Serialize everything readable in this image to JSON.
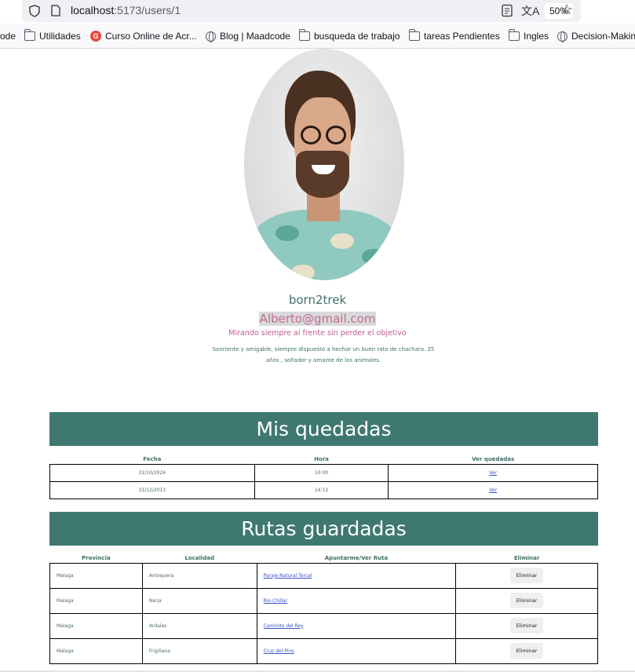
{
  "browser": {
    "url_host": "localhost",
    "url_rest": ":5173/users/1",
    "zoom": "50%",
    "bookmarks": [
      {
        "label": "ode",
        "icon": "none"
      },
      {
        "label": "Utilidades",
        "icon": "folder-icon"
      },
      {
        "label": "Curso Online de Acr...",
        "icon": "g-logo-icon"
      },
      {
        "label": "Blog | Maadcode",
        "icon": "globe-icon"
      },
      {
        "label": "busqueda de trabajo",
        "icon": "folder-icon"
      },
      {
        "label": "tareas Pendientes",
        "icon": "folder-icon"
      },
      {
        "label": "Ingles",
        "icon": "folder-icon"
      },
      {
        "label": "Decision-Makin",
        "icon": "globe-icon"
      }
    ]
  },
  "profile": {
    "username": "born2trek",
    "email": "Alberto@gmail.com",
    "slogan": "Mirando siempre al frente sin perder el objetivo",
    "bio_line1": "Sonriente y amigable, siempre dispuesto a hechar un buen rato de chachara. 25",
    "bio_line2": "años , soñador y amante de los animales."
  },
  "quedadas": {
    "title": "Mis quedadas",
    "headers": [
      "Fecha",
      "Hora",
      "Ver quedadas"
    ],
    "rows": [
      {
        "fecha": "31/10/2024",
        "hora": "10:00",
        "link": "Ver"
      },
      {
        "fecha": "31/12/2013",
        "hora": "14:12",
        "link": "Ver"
      }
    ]
  },
  "rutas": {
    "title": "Rutas guardadas",
    "headers": [
      "Provincia",
      "Localidad",
      "Apuntarme/Ver Ruta",
      "Eliminar"
    ],
    "delete_label": "Eliminar",
    "rows": [
      {
        "provincia": "Malaga",
        "localidad": "Antequera",
        "ruta": "Paraje Natural Torcal"
      },
      {
        "provincia": "Malaga",
        "localidad": "Nerja",
        "ruta": "Rio Chillar"
      },
      {
        "provincia": "Malaga",
        "localidad": "Ardales",
        "ruta": "Caminito del Rey"
      },
      {
        "provincia": "Malaga",
        "localidad": "Frigiliana",
        "ruta": "Cruz del Pino"
      }
    ]
  },
  "colors": {
    "accent": "#3e7870",
    "email_text": "#c06d98",
    "slogan_text": "#c05a8f"
  }
}
